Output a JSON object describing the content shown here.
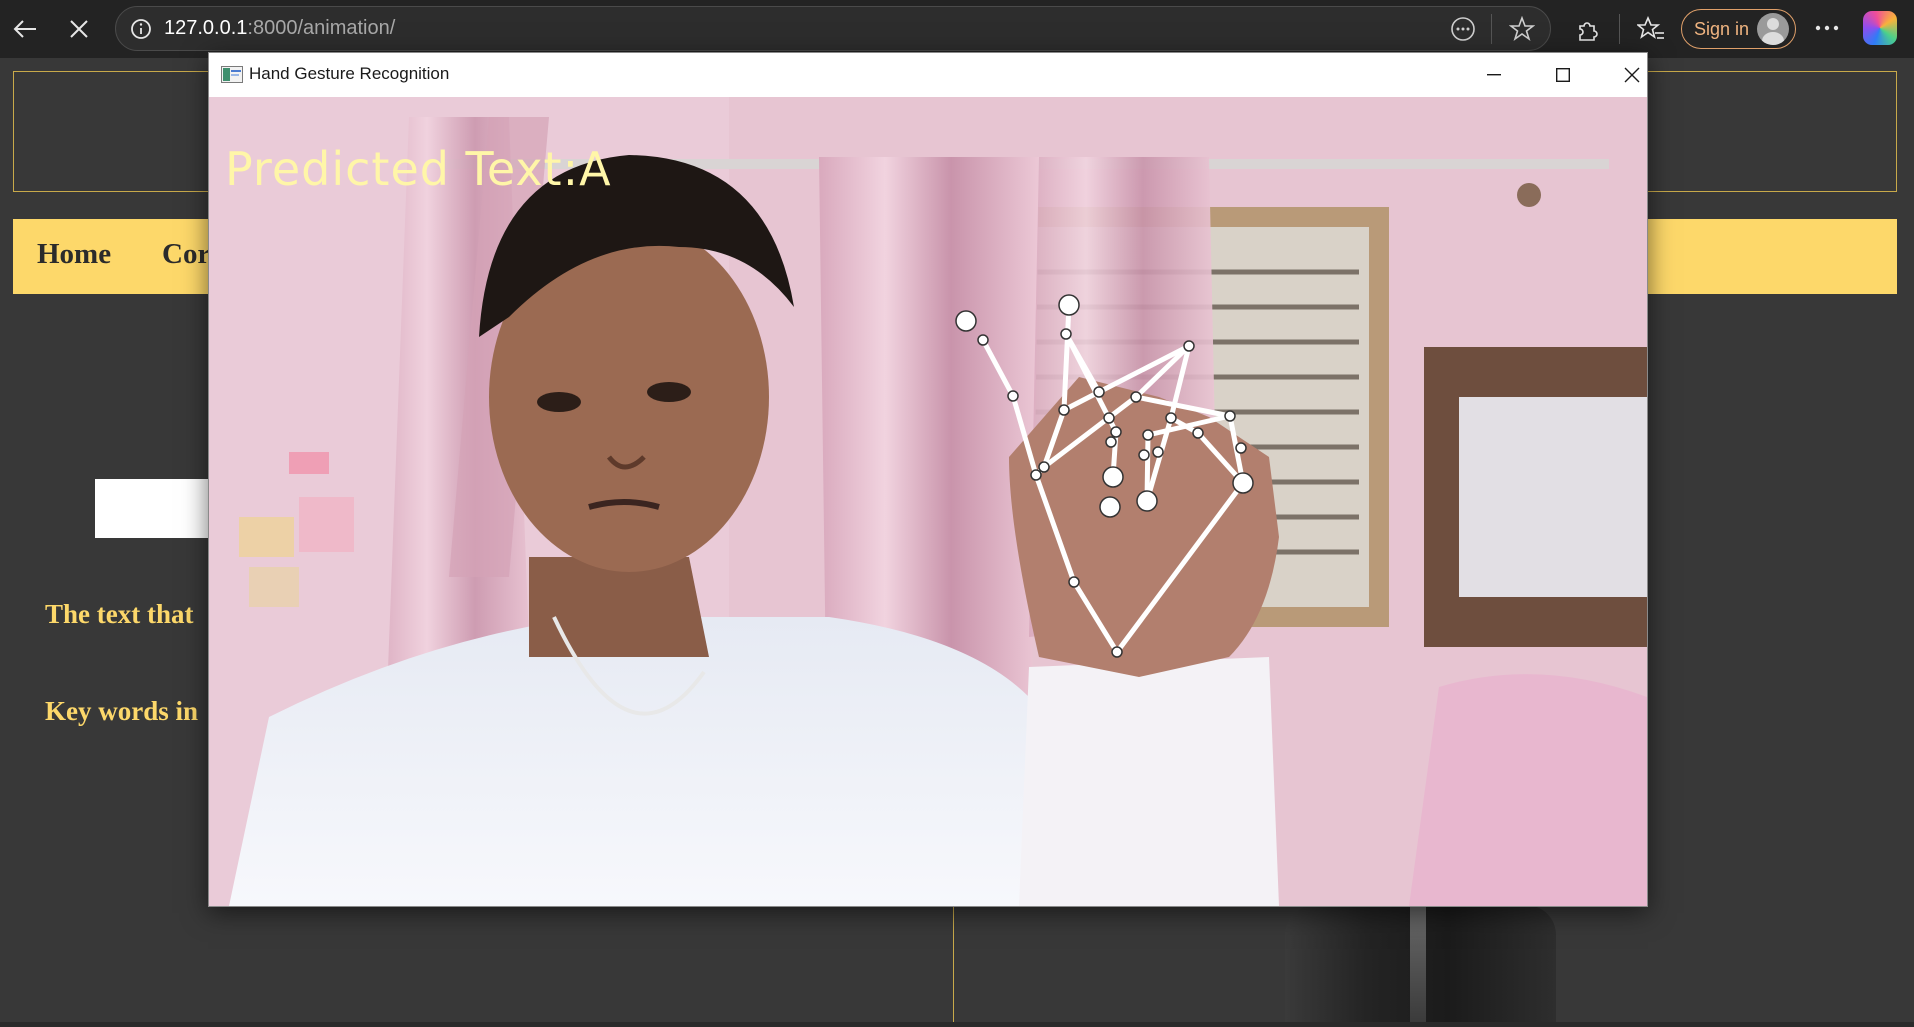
{
  "browser": {
    "url_host": "127.0.0.1",
    "url_path": ":8000/animation/",
    "sign_in_label": "Sign in"
  },
  "page": {
    "nav_items": [
      "Home",
      "Cor"
    ],
    "text_line_1": "The text that",
    "text_line_2": "Key words in"
  },
  "app_window": {
    "title": "Hand Gesture Recognition",
    "overlay_text": "Predicted Text:A"
  },
  "colors": {
    "accent": "#fdd86a",
    "overlay_text": "#fff6a8",
    "page_bg": "#383838"
  }
}
